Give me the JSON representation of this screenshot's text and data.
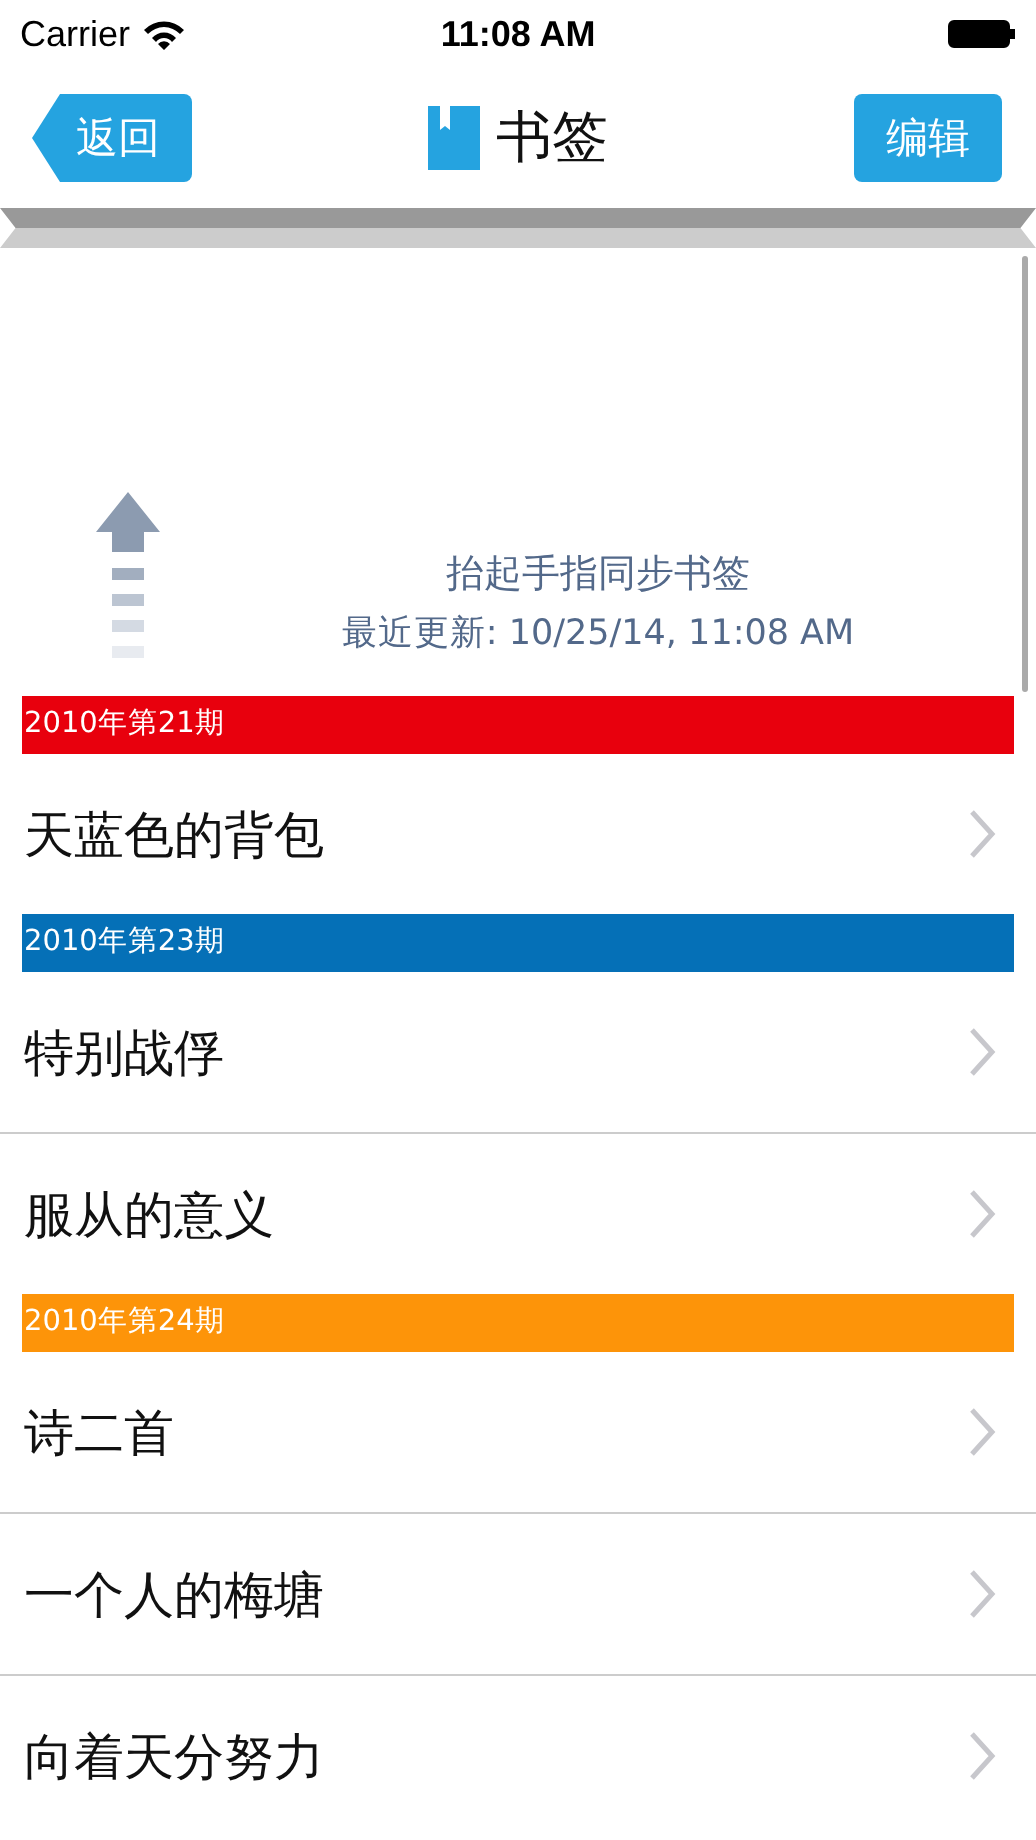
{
  "status_bar": {
    "carrier": "Carrier",
    "time": "11:08 AM"
  },
  "nav": {
    "back": "返回",
    "title": "书签",
    "edit": "编辑"
  },
  "pull": {
    "message": "抬起手指同步书签",
    "updated": "最近更新: 10/25/14, 11:08 AM"
  },
  "sections": [
    {
      "title": "2010年第21期",
      "color": "#e8000d",
      "items": [
        "天蓝色的背包"
      ]
    },
    {
      "title": "2010年第23期",
      "color": "#0570b7",
      "items": [
        "特别战俘",
        "服从的意义"
      ]
    },
    {
      "title": "2010年第24期",
      "color": "#fd9409",
      "items": [
        "诗二首",
        "一个人的梅塘",
        "向着天分努力"
      ]
    }
  ]
}
